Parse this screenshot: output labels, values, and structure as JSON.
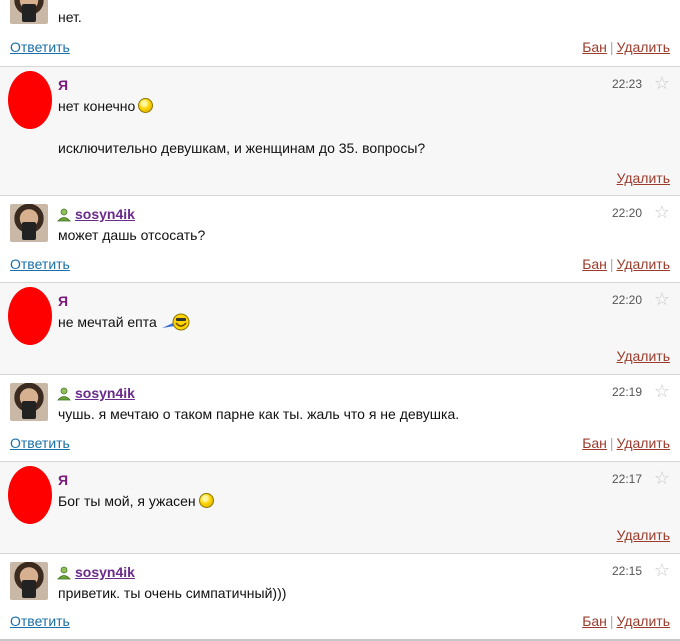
{
  "messages": [
    {
      "kind": "other",
      "author": "",
      "time": "",
      "text": "нет.",
      "reply": "Ответить",
      "ban": "Бан",
      "delete": "Удалить"
    },
    {
      "kind": "me",
      "author": "Я",
      "time": "22:23",
      "text": "нет конечно",
      "text2": "исключительно девушкам, и женщинам до 35. вопросы?",
      "delete": "Удалить"
    },
    {
      "kind": "other",
      "author": "sosyn4ik",
      "time": "22:20",
      "text": "может дашь отсосать?",
      "reply": "Ответить",
      "ban": "Бан",
      "delete": "Удалить"
    },
    {
      "kind": "me",
      "author": "Я",
      "time": "22:20",
      "text": "не мечтай епта",
      "delete": "Удалить"
    },
    {
      "kind": "other",
      "author": "sosyn4ik",
      "time": "22:19",
      "text": "чушь. я мечтаю о таком парне как ты. жаль что я не девушка.",
      "reply": "Ответить",
      "ban": "Бан",
      "delete": "Удалить"
    },
    {
      "kind": "me",
      "author": "Я",
      "time": "22:17",
      "text": "Бог ты мой, я ужасен",
      "delete": "Удалить"
    },
    {
      "kind": "other",
      "author": "sosyn4ik",
      "time": "22:15",
      "text": "приветик. ты очень симпатичный)))",
      "reply": "Ответить",
      "ban": "Бан",
      "delete": "Удалить"
    }
  ],
  "icons": {
    "star": "star-icon",
    "user": "user-icon",
    "smiley": "smiley-icon",
    "cool": "cool-emoticon-icon"
  },
  "colors": {
    "reply_link": "#1a6fa8",
    "delete_link": "#9b3b2b",
    "author_me": "#7a1a7a",
    "author_user": "#6a2b8a"
  }
}
